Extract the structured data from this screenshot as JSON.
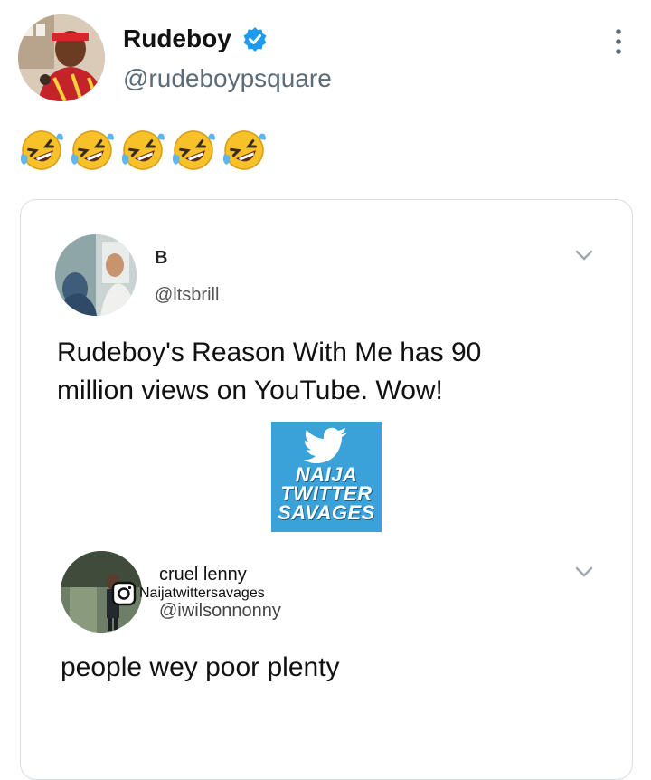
{
  "tweet": {
    "author_name": "Rudeboy",
    "author_handle": "@rudeboypsquare",
    "emoji_count": 5,
    "emoji": "rolling-on-the-floor-laughing"
  },
  "quoted_image": {
    "first_tweet": {
      "name": "B",
      "handle": "@ltsbrill",
      "text": "Rudeboy's Reason With Me has 90 million views on YouTube. Wow!"
    },
    "watermark": {
      "lines": [
        "NAIJA",
        "TWITTER",
        "SAVAGES"
      ],
      "color": "#3aa2d8"
    },
    "reply": {
      "name": "cruel lenny",
      "instagram_tag": "Naijatwittersavages",
      "handle": "@iwilsonnonny",
      "text": "people wey poor plenty"
    }
  },
  "colors": {
    "verified": "#1d9bf0",
    "handle_grey": "#5b6b78",
    "card_border": "#d9dee3"
  }
}
